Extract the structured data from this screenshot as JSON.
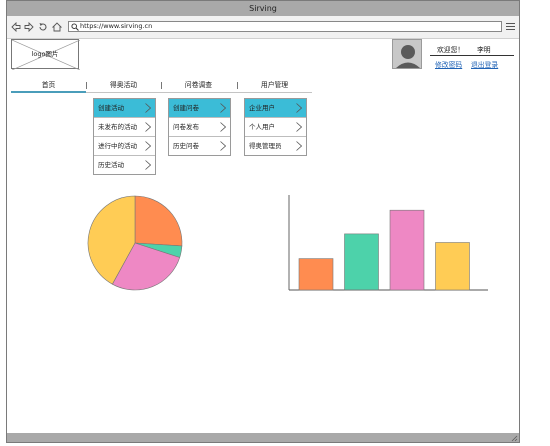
{
  "window": {
    "title": "Sirving"
  },
  "browser": {
    "url": "https://www.sirving.cn"
  },
  "header": {
    "logo_text": "logo图片",
    "welcome": "欢迎您！",
    "username": "李明",
    "change_password": "修改密码",
    "logout": "退出登录"
  },
  "nav": {
    "items": [
      {
        "label": "首页"
      },
      {
        "label": "得奥活动"
      },
      {
        "label": "问卷调查"
      },
      {
        "label": "用户管理"
      }
    ]
  },
  "dropdowns": [
    {
      "items": [
        {
          "label": "创建活动",
          "highlight": true
        },
        {
          "label": "未发布的活动"
        },
        {
          "label": "进行中的活动"
        },
        {
          "label": "历史活动"
        }
      ]
    },
    {
      "items": [
        {
          "label": "创建问卷",
          "highlight": true
        },
        {
          "label": "问卷发布"
        },
        {
          "label": "历史问卷"
        }
      ]
    },
    {
      "items": [
        {
          "label": "企业用户",
          "highlight": true
        },
        {
          "label": "个人用户"
        },
        {
          "label": "得奥管理员"
        }
      ]
    }
  ],
  "colors": {
    "highlight": "#3bbcd7",
    "orange": "#ff8c50",
    "teal": "#4dd2aa",
    "pink": "#ee88c4",
    "yellow": "#ffcc55",
    "link": "#1f62b5"
  },
  "chart_data": [
    {
      "type": "pie",
      "values": [
        26,
        4,
        28,
        42
      ],
      "colors": [
        "#ff8c50",
        "#4dd2aa",
        "#ee88c4",
        "#ffcc55"
      ]
    },
    {
      "type": "bar",
      "values": [
        33,
        59,
        84,
        50
      ],
      "ylim": [
        0,
        100
      ],
      "colors": [
        "#ff8c50",
        "#4dd2aa",
        "#ee88c4",
        "#ffcc55"
      ]
    }
  ]
}
